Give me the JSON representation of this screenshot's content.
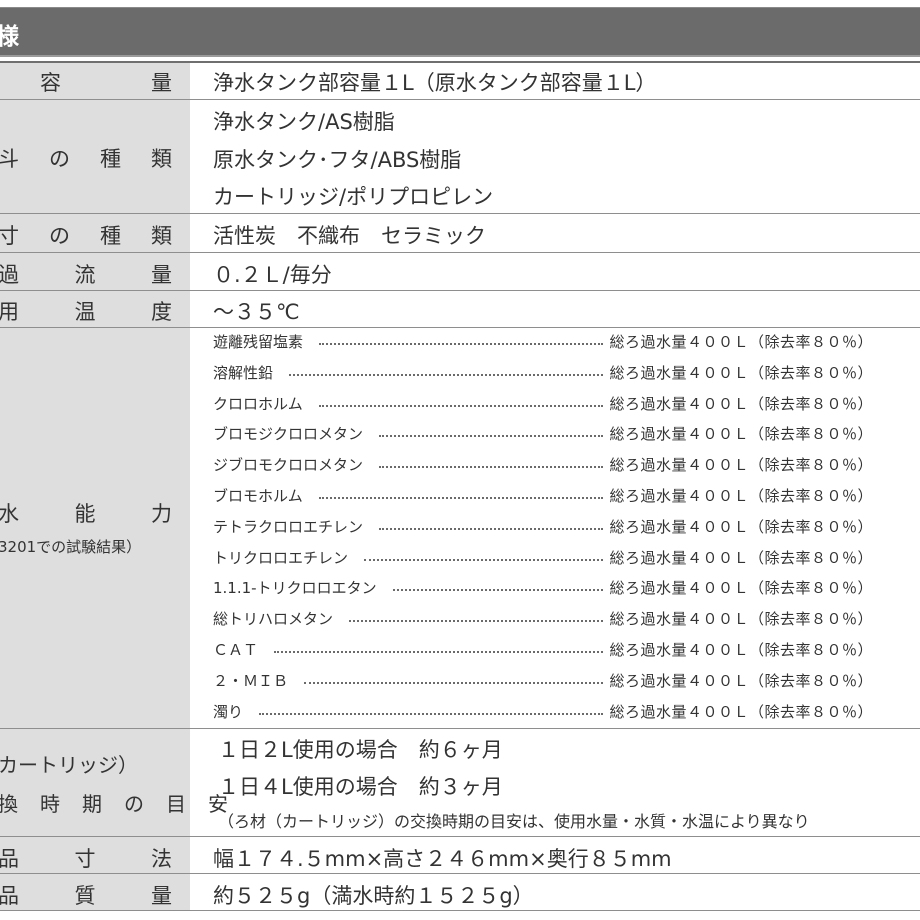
{
  "header": {
    "title": "様"
  },
  "rows": {
    "capacity": {
      "label": "容　　量",
      "value": "浄水タンク部容量１L（原水タンク部容量１L）"
    },
    "materials": {
      "label": "斗　の　種　類",
      "lines": [
        "浄水タンク/AS樹脂",
        "原水タンク･フタ/ABS樹脂",
        "カートリッジ/ポリプロピレン"
      ]
    },
    "filter_media": {
      "label": "寸　の　種　類",
      "value": "活性炭　不織布　セラミック"
    },
    "flow_rate": {
      "label": "過　流　量",
      "value": "０.２Ｌ/毎分"
    },
    "temperature": {
      "label": "用　温　度",
      "value": "～３５℃"
    },
    "performance": {
      "label": "水　能　力",
      "sublabel": "3201での試験結果）",
      "items": [
        {
          "name": "遊離残留塩素",
          "result": "総ろ過水量４００Ｌ（除去率８０％）"
        },
        {
          "name": "溶解性鉛",
          "result": "総ろ過水量４００Ｌ（除去率８０％）"
        },
        {
          "name": "クロロホルム",
          "result": "総ろ過水量４００Ｌ（除去率８０％）"
        },
        {
          "name": "ブロモジクロロメタン",
          "result": "総ろ過水量４００Ｌ（除去率８０％）"
        },
        {
          "name": "ジブロモクロロメタン",
          "result": "総ろ過水量４００Ｌ（除去率８０％）"
        },
        {
          "name": "ブロモホルム",
          "result": "総ろ過水量４００Ｌ（除去率８０％）"
        },
        {
          "name": "テトラクロロエチレン",
          "result": "総ろ過水量４００Ｌ（除去率８０％）"
        },
        {
          "name": "トリクロロエチレン",
          "result": "総ろ過水量４００Ｌ（除去率８０％）"
        },
        {
          "name": "1.1.1-トリクロロエタン",
          "result": "総ろ過水量４００Ｌ（除去率８０％）"
        },
        {
          "name": "総トリハロメタン",
          "result": "総ろ過水量４００Ｌ（除去率８０％）"
        },
        {
          "name": "ＣＡＴ",
          "result": "総ろ過水量４００Ｌ（除去率８０％）"
        },
        {
          "name": "２・ＭＩＢ",
          "result": "総ろ過水量４００Ｌ（除去率８０％）"
        },
        {
          "name": "濁り",
          "result": "総ろ過水量４００Ｌ（除去率８０％）"
        }
      ]
    },
    "replacement": {
      "label_line1": "カートリッジ）",
      "label_line2": "換　時　期　の　目　安",
      "lines": [
        "１日２L使用の場合　約６ヶ月",
        "１日４L使用の場合　約３ヶ月"
      ],
      "note": "（ろ材（カートリッジ）の交換時期の目安は、使用水量・水質・水温により異なり"
    },
    "dimensions": {
      "label": "品　寸　法",
      "value": "幅１７４.５mm×高さ２４６mm×奥行８５mm"
    },
    "weight": {
      "label": "品　質　量",
      "value": "約５２５g（満水時約１５２５g）"
    }
  }
}
